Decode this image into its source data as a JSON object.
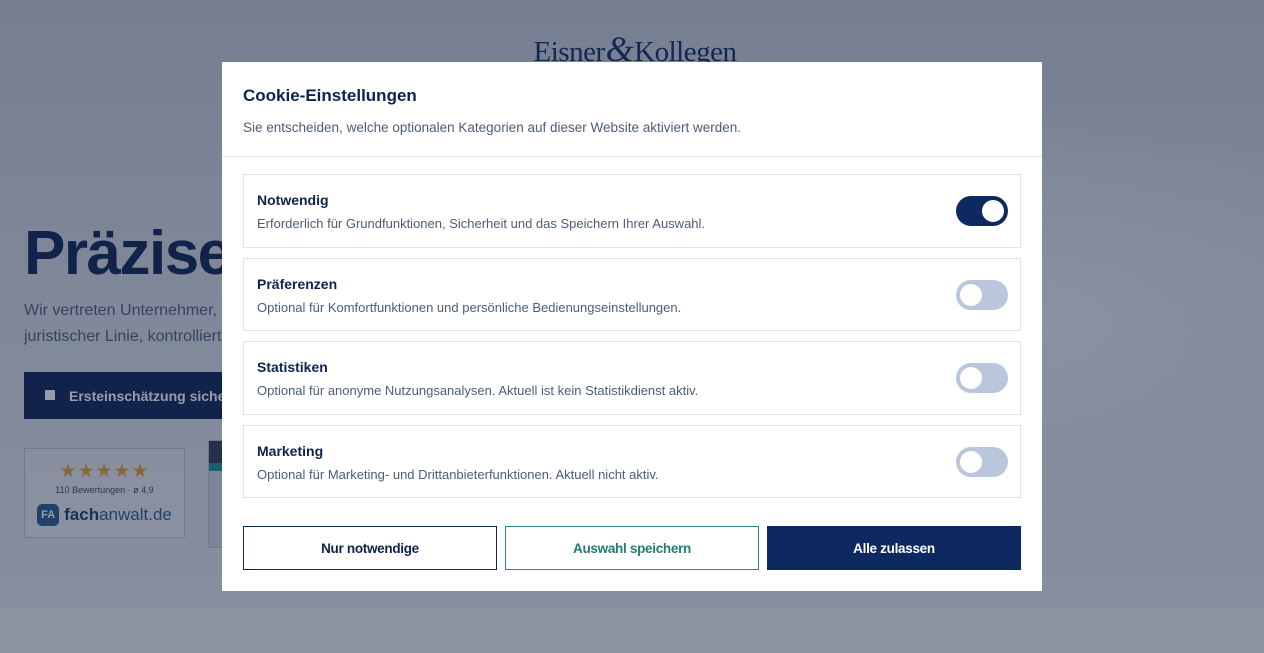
{
  "background_page": {
    "logo_text_left": "Eisner",
    "logo_amp": "&",
    "logo_text_right": "Kollegen",
    "hero_title": "Präzise",
    "hero_text_line1": "Wir vertreten Unternehmer, F",
    "hero_text_line2": "juristischer Linie, kontrollierte",
    "cta_label": "Ersteinschätzung sicherr",
    "rating": {
      "stars": "★★★★★",
      "count_text": "110 Bewertungen · ø 4,9",
      "badge_icon_text": "FA",
      "brand_bold": "fach",
      "brand_rest": "anwalt.de"
    }
  },
  "modal": {
    "title": "Cookie-Einstellungen",
    "subtitle": "Sie entscheiden, welche optionalen Kategorien auf dieser Website aktiviert werden.",
    "categories": [
      {
        "name": "Notwendig",
        "description": "Erforderlich für Grundfunktionen, Sicherheit und das Speichern Ihrer Auswahl.",
        "enabled": true
      },
      {
        "name": "Präferenzen",
        "description": "Optional für Komfortfunktionen und persönliche Bedienungseinstellungen.",
        "enabled": false
      },
      {
        "name": "Statistiken",
        "description": "Optional für anonyme Nutzungsanalysen. Aktuell ist kein Statistikdienst aktiv.",
        "enabled": false
      },
      {
        "name": "Marketing",
        "description": "Optional für Marketing- und Drittanbieterfunktionen. Aktuell nicht aktiv.",
        "enabled": false
      }
    ],
    "buttons": {
      "necessary_only": "Nur notwendige",
      "save_selection": "Auswahl speichern",
      "accept_all": "Alle zulassen"
    }
  },
  "colors": {
    "primary": "#0d2960",
    "toggle_off": "#b9c6dc",
    "save_accent": "#237e72",
    "star": "#e0a23a"
  }
}
